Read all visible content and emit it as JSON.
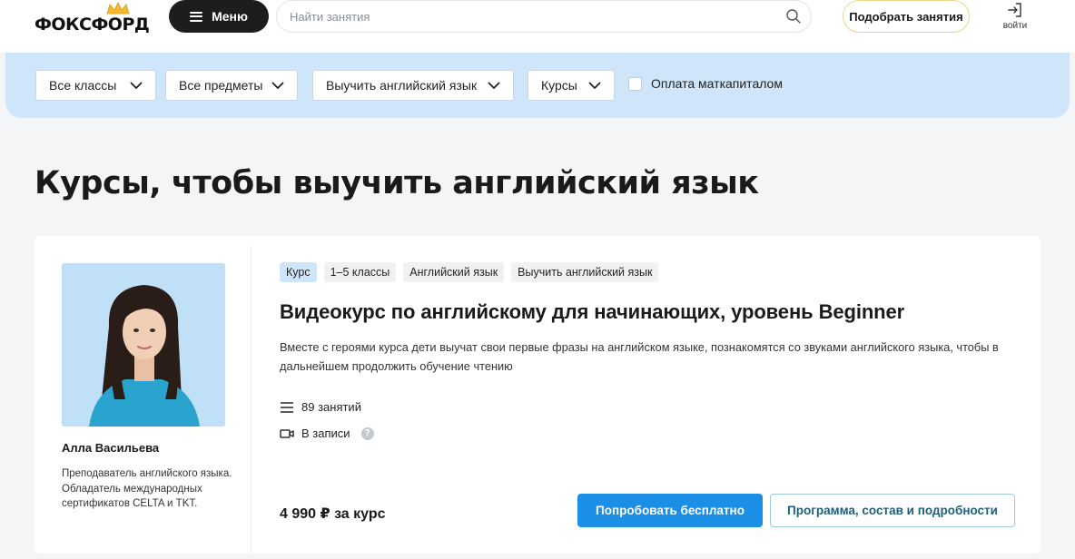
{
  "header": {
    "logo_text": "ФОКСФОРД",
    "menu_label": "Меню",
    "search_placeholder": "Найти занятия",
    "pick_button_label": "Подобрать занятия",
    "login_label": "войти"
  },
  "filters": {
    "dropdowns": [
      {
        "label": "Все классы"
      },
      {
        "label": "Все предметы"
      },
      {
        "label": "Выучить английский язык"
      },
      {
        "label": "Курсы"
      }
    ],
    "checkbox_label": "Оплата маткапиталом",
    "checkbox_checked": false
  },
  "page_title": "Курсы, чтобы выучить английский язык",
  "course": {
    "tags": [
      "Курс",
      "1–5 классы",
      "Английский язык",
      "Выучить английский язык"
    ],
    "title": "Видеокурс по английскому для начинающих, уровень Beginner",
    "description": "Вместе с героями курса дети выучат свои первые фразы на английском языке, познакомятся со звуками английского языка, чтобы в дальнейшем продолжить обучение чтению",
    "lessons": "89 занятий",
    "format": "В записи",
    "price": "4 990 ₽ за курс",
    "try_button_label": "Попробовать бесплатно",
    "program_button_label": "Программа, состав и подробности",
    "teacher": {
      "name": "Алла Васильева",
      "description": "Преподаватель английского языка. Обладатель международных сертификатов CELTA и TKT."
    }
  },
  "colors": {
    "accent_blue": "#1b8fe6",
    "filter_bg": "#cfe6fa",
    "menu_bg": "#1f1d1c",
    "page_bg": "#f4f5f7"
  },
  "icons": {
    "menu": "menu-icon",
    "search": "search-icon",
    "login": "login-icon",
    "dropdown": "chevron-down-icon",
    "lessons": "list-icon",
    "format": "video-icon",
    "help": "question-icon"
  }
}
